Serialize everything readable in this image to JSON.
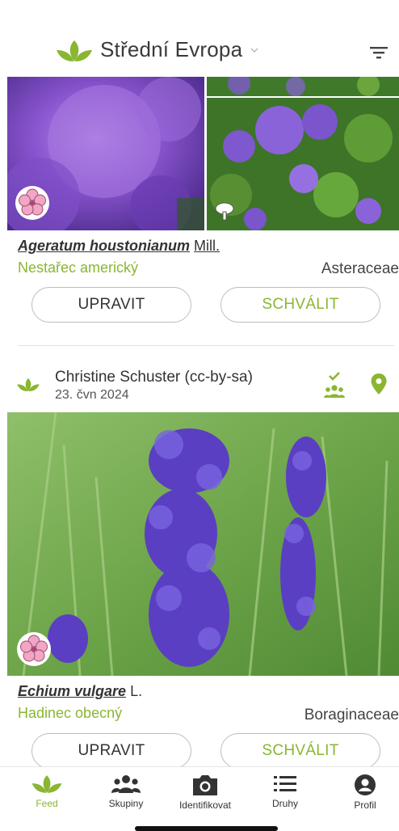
{
  "header": {
    "region_title": "Střední Evropa"
  },
  "cards": [
    {
      "scientific_name": "Ageratum houstonianum",
      "author": "Mill.",
      "common_name": "Nestařec americký",
      "family": "Asteraceae",
      "edit_label": "UPRAVIT",
      "approve_label": "SCHVÁLIT"
    },
    {
      "observer": "Christine Schuster (cc-by-sa)",
      "date": "23. čvn 2024",
      "scientific_name": "Echium vulgare",
      "author": "L.",
      "common_name": "Hadinec obecný",
      "family": "Boraginaceae",
      "edit_label": "UPRAVIT",
      "approve_label": "SCHVÁLIT"
    }
  ],
  "nav": [
    {
      "label": "Feed",
      "icon": "feed-icon",
      "active": true
    },
    {
      "label": "Skupiny",
      "icon": "groups-icon",
      "active": false
    },
    {
      "label": "Identifikovat",
      "icon": "camera-icon",
      "active": false
    },
    {
      "label": "Druhy",
      "icon": "list-icon",
      "active": false
    },
    {
      "label": "Profil",
      "icon": "profile-icon",
      "active": false
    }
  ],
  "colors": {
    "accent": "#8ab631",
    "text": "#333333",
    "divider": "#e2e2e2"
  }
}
